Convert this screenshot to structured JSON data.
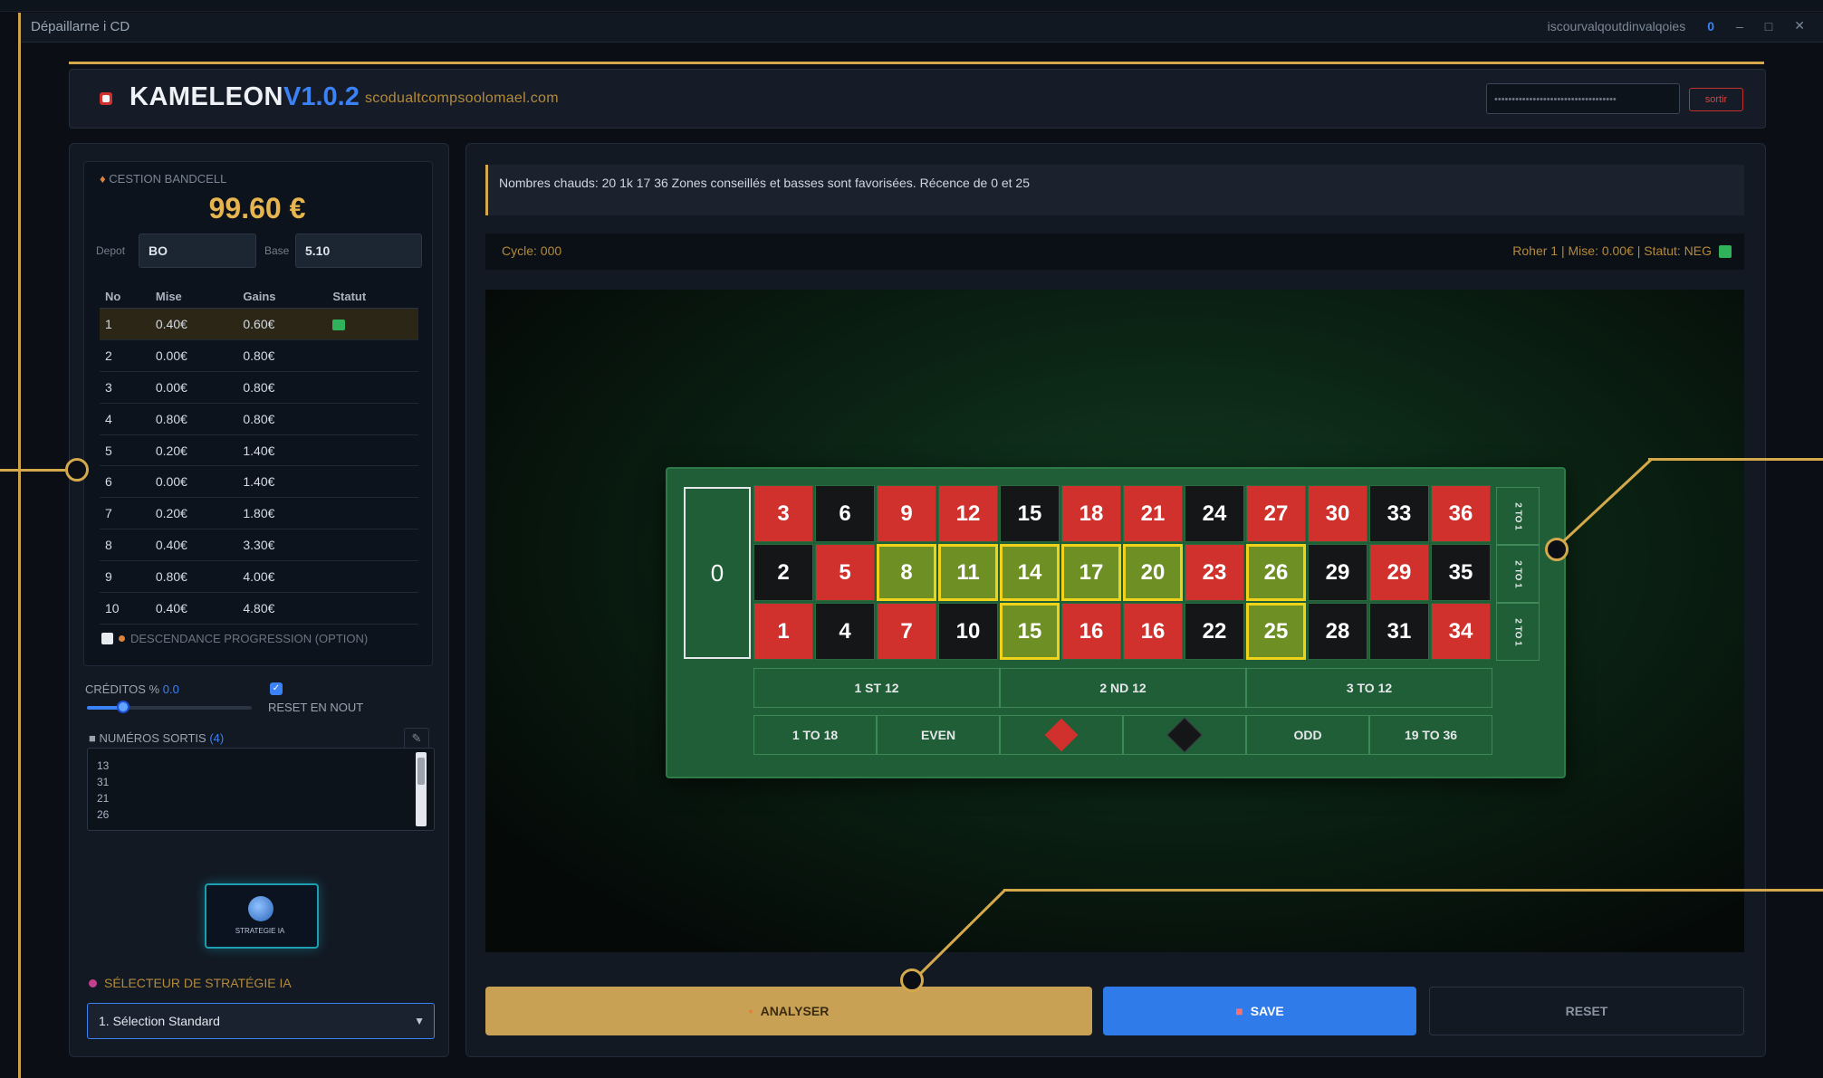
{
  "window": {
    "title": "Dépaillarne i CD",
    "right_text": "iscourvalqoutdinvalqoies",
    "controls": [
      "0",
      "–",
      "□",
      "✕"
    ]
  },
  "header": {
    "brand": "KAMELEON",
    "version": "V1.0.2",
    "url": "scodualtcompsoolomael.com",
    "key_placeholder": "•••••••••••••••••••••••••••••••••••",
    "logout_label": "sortir"
  },
  "bankroll": {
    "label": "CESTION BANDCELL",
    "value": "99.60 €",
    "deposit_label": "Depot",
    "deposit_value": "BO",
    "base_label": "Base",
    "base_value": "5.10",
    "table": {
      "headers": [
        "No",
        "Mise",
        "Gains",
        "Statut"
      ],
      "rows": [
        {
          "n": "1",
          "mise": "0.40€",
          "gain": "0.60€",
          "status": true
        },
        {
          "n": "2",
          "mise": "0.00€",
          "gain": "0.80€",
          "status": false
        },
        {
          "n": "3",
          "mise": "0.00€",
          "gain": "0.80€",
          "status": false
        },
        {
          "n": "4",
          "mise": "0.80€",
          "gain": "0.80€",
          "status": false
        },
        {
          "n": "5",
          "mise": "0.20€",
          "gain": "1.40€",
          "status": false
        },
        {
          "n": "6",
          "mise": "0.00€",
          "gain": "1.40€",
          "status": false
        },
        {
          "n": "7",
          "mise": "0.20€",
          "gain": "1.80€",
          "status": false
        },
        {
          "n": "8",
          "mise": "0.40€",
          "gain": "3.30€",
          "status": false
        },
        {
          "n": "9",
          "mise": "0.80€",
          "gain": "4.00€",
          "status": false
        },
        {
          "n": "10",
          "mise": "0.40€",
          "gain": "4.80€",
          "status": false
        }
      ]
    },
    "auto_label": "DESCENDANCE PROGRESSION (OPTION)"
  },
  "controls": {
    "intensity_label": "CRÉDITOS %",
    "intensity_value": "0.0",
    "intensity_fraction": 0.22,
    "reset_label": "RESET EN NOUT",
    "numbers_label": "NUMÉROS SORTIS",
    "numbers_count": "(4)",
    "numbers": [
      "13",
      "31",
      "21",
      "26"
    ],
    "edit_icon": "pencil-icon"
  },
  "ia_logo": {
    "caption": "STRATEGIE IA"
  },
  "strategy": {
    "label": "SÉLECTEUR DE STRATÉGIE IA",
    "selected": "1. Sélection Standard"
  },
  "message": "Nombres chauds: 20 1k 17 36 Zones conseillés et basses sont favorisées. Récence de 0 et 25",
  "cycle": {
    "left": "Cycle: 000",
    "right": "Roher 1 | Mise: 0.00€ | Statut: NEG"
  },
  "board": {
    "zero": "0",
    "top_row": [
      {
        "n": "3",
        "c": "red"
      },
      {
        "n": "6",
        "c": "black"
      },
      {
        "n": "9",
        "c": "red"
      },
      {
        "n": "12",
        "c": "red"
      },
      {
        "n": "15",
        "c": "black"
      },
      {
        "n": "18",
        "c": "red"
      },
      {
        "n": "21",
        "c": "red"
      },
      {
        "n": "24",
        "c": "black"
      },
      {
        "n": "27",
        "c": "red"
      },
      {
        "n": "30",
        "c": "red"
      },
      {
        "n": "33",
        "c": "black"
      },
      {
        "n": "36",
        "c": "red"
      }
    ],
    "mid_row": [
      {
        "n": "2",
        "c": "black"
      },
      {
        "n": "5",
        "c": "red"
      },
      {
        "n": "8",
        "c": "hl"
      },
      {
        "n": "11",
        "c": "hl"
      },
      {
        "n": "14",
        "c": "hl"
      },
      {
        "n": "17",
        "c": "hl"
      },
      {
        "n": "20",
        "c": "hl"
      },
      {
        "n": "23",
        "c": "red"
      },
      {
        "n": "26",
        "c": "hl"
      },
      {
        "n": "29",
        "c": "black"
      },
      {
        "n": "29",
        "c": "red"
      },
      {
        "n": "35",
        "c": "black"
      }
    ],
    "bot_row": [
      {
        "n": "1",
        "c": "red"
      },
      {
        "n": "4",
        "c": "black"
      },
      {
        "n": "7",
        "c": "red"
      },
      {
        "n": "10",
        "c": "black"
      },
      {
        "n": "15",
        "c": "hl"
      },
      {
        "n": "16",
        "c": "red"
      },
      {
        "n": "16",
        "c": "red"
      },
      {
        "n": "22",
        "c": "black"
      },
      {
        "n": "25",
        "c": "hl"
      },
      {
        "n": "28",
        "c": "black"
      },
      {
        "n": "31",
        "c": "black"
      },
      {
        "n": "34",
        "c": "red"
      }
    ],
    "columns": [
      "2 TO 1",
      "2 TO 1",
      "2 TO 1"
    ],
    "dozens": [
      "1 ST 12",
      "2 ND 12",
      "3 TO 12"
    ],
    "evens": [
      "1 TO 18",
      "EVEN",
      "",
      "",
      "ODD",
      "19 TO 36"
    ],
    "red_color": "#d0312d",
    "black_color": "#141618",
    "highlight_color": "#6e8f24"
  },
  "actions": {
    "analyse": "ANALYSER",
    "save": "SAVE",
    "reset": "RESET"
  }
}
